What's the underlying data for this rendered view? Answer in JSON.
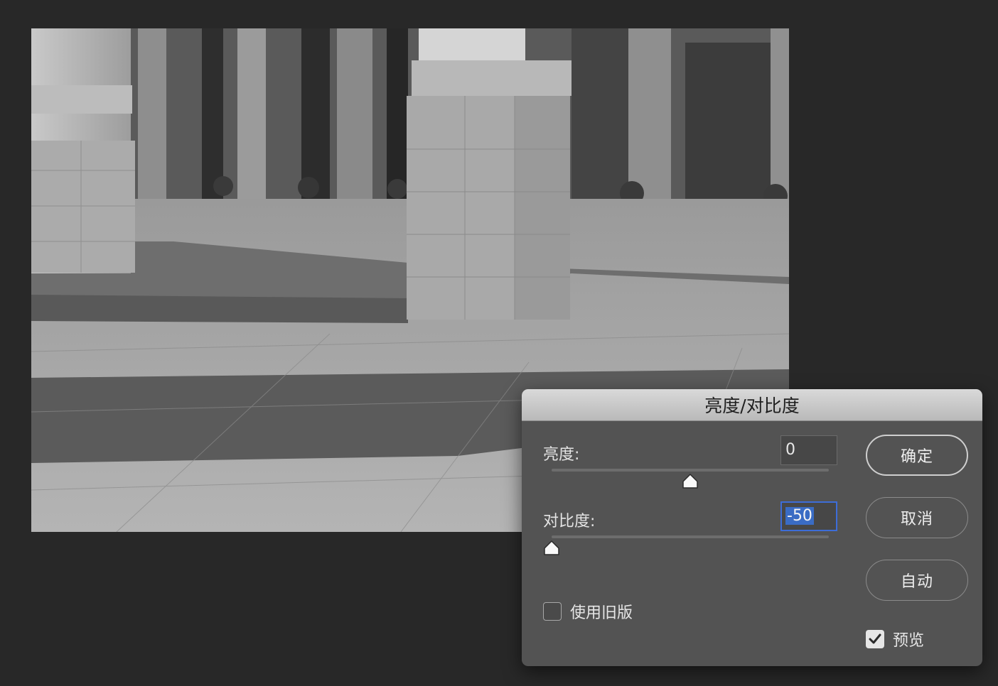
{
  "dialog": {
    "title": "亮度/对比度",
    "brightness": {
      "label": "亮度:",
      "value": "0",
      "slider_fraction": 0.5
    },
    "contrast": {
      "label": "对比度:",
      "value": "-50",
      "slider_fraction": 0.0
    },
    "buttons": {
      "ok": "确定",
      "cancel": "取消",
      "auto": "自动"
    },
    "legacy": {
      "label": "使用旧版",
      "checked": false
    },
    "preview": {
      "label": "预览",
      "checked": true
    }
  },
  "colors": {
    "dialog_bg": "#535353",
    "focus_accent": "#3d6dd8",
    "app_bg": "#282828"
  },
  "icons": {
    "thumb": "slider-thumb-icon",
    "check": "checkmark-icon"
  }
}
